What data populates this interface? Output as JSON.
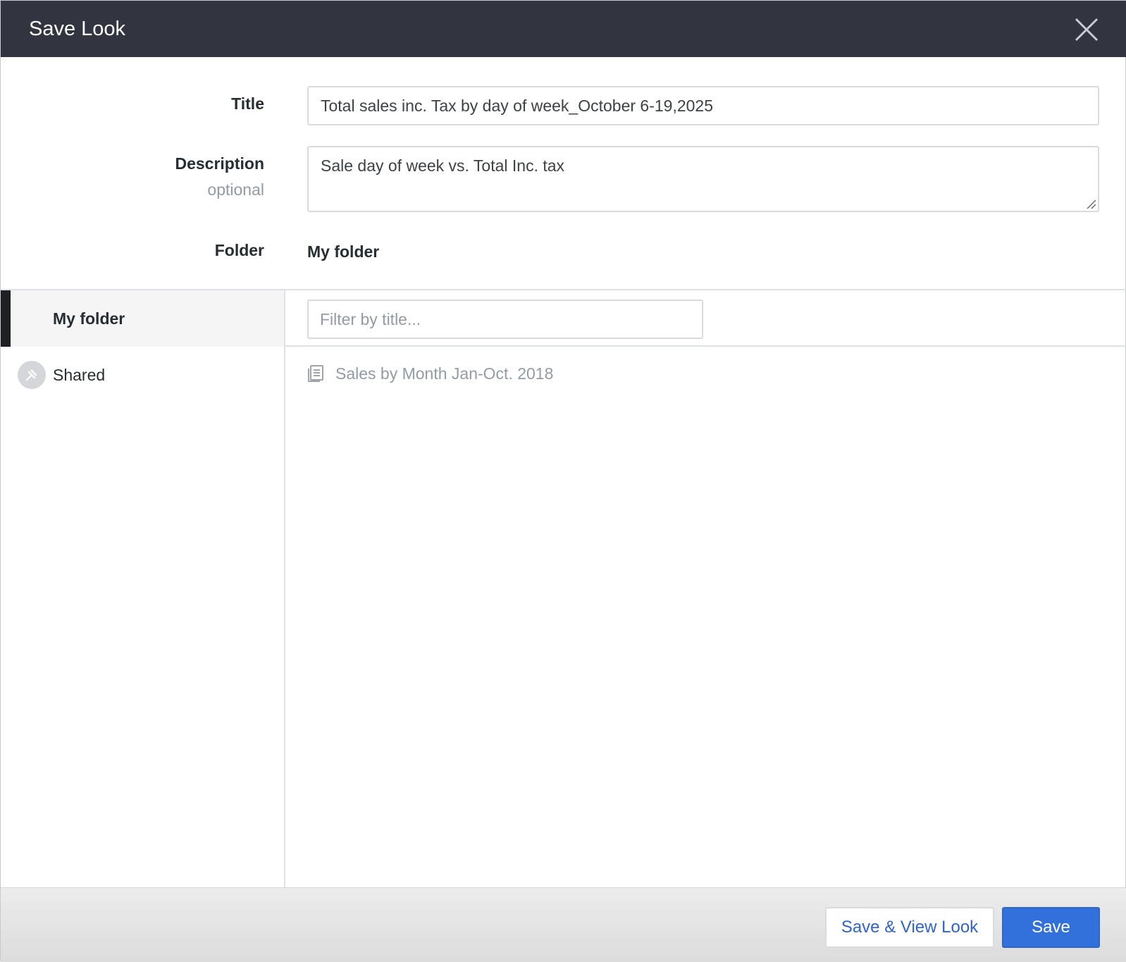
{
  "dialog": {
    "title": "Save Look",
    "close_icon": "close-icon"
  },
  "form": {
    "title_label": "Title",
    "title_value": "Total sales inc. Tax by day of week_October 6-19,2025",
    "description_label": "Description",
    "description_optional": "optional",
    "description_value": "Sale day of week vs. Total Inc. tax",
    "folder_label": "Folder",
    "folder_value": "My folder"
  },
  "sidebar": {
    "items": [
      {
        "label": "My folder",
        "active": true
      },
      {
        "label": "Shared",
        "icon": "pin-icon",
        "active": false
      }
    ]
  },
  "content": {
    "filter_placeholder": "Filter by title...",
    "looks": [
      {
        "title": "Sales by Month Jan-Oct. 2018",
        "icon": "document-icon"
      }
    ]
  },
  "footer": {
    "save_view_label": "Save & View Look",
    "save_label": "Save"
  },
  "colors": {
    "header_bg": "#323540",
    "primary": "#3270dc",
    "link": "#2f63cf",
    "muted": "#939ba5"
  }
}
